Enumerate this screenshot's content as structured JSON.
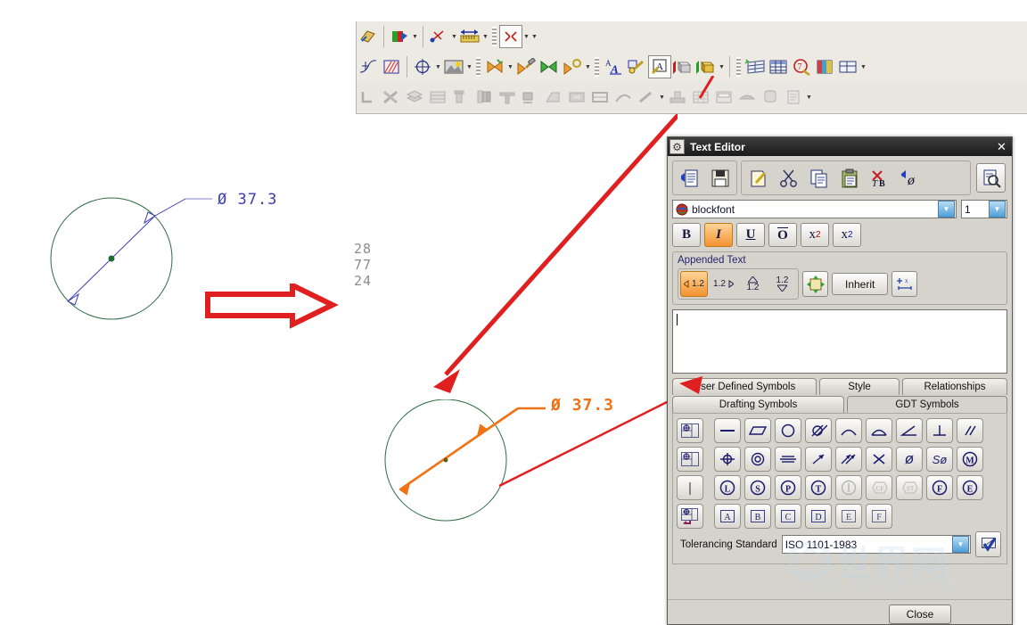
{
  "app": {
    "canvas_bg": "#ffffff",
    "accent_orange": "#ef7215",
    "accent_blue": "#3b3bb5",
    "arrow_red": "#e02020"
  },
  "cad_canvas": {
    "drawing_before": {
      "dimension_label": "Ø  37.3",
      "circle_color": "#2e6b45",
      "dimension_color": "#3b3bb5",
      "center_dot_color": "#1d6b33"
    },
    "drawing_after": {
      "dimension_label": "Ø  37.3",
      "circle_color": "#2e6b45",
      "dimension_color": "#ef7215"
    },
    "gray_numbers": [
      "28",
      "77",
      "24"
    ],
    "transition_arrow": "red-outline-right-arrow"
  },
  "cad_toolbars": {
    "row1": [
      {
        "name": "datum-plane-icon",
        "glyph": "◩",
        "disabled": false
      },
      {
        "name": "section-view-icon",
        "glyph": "◢",
        "disabled": false
      },
      {
        "name": "measure-distance-icon",
        "glyph": "↔",
        "disabled": false
      },
      {
        "name": "ruler-icon",
        "glyph": "▬",
        "disabled": false
      },
      {
        "name": "fit-view-icon",
        "glyph": "⤢",
        "disabled": false
      }
    ],
    "row2": [
      {
        "name": "spline-icon",
        "glyph": "∿",
        "disabled": false
      },
      {
        "name": "crosshatch-icon",
        "glyph": "▦",
        "disabled": false
      },
      {
        "name": "center-mark-icon",
        "glyph": "⊕",
        "disabled": false
      },
      {
        "name": "shading-icon",
        "glyph": "▣",
        "disabled": false
      },
      {
        "name": "assembly-constraint-icon",
        "glyph": "⋈",
        "disabled": false
      },
      {
        "name": "hammer-tool-icon",
        "glyph": "⚒",
        "disabled": false
      },
      {
        "name": "wrench-icon",
        "glyph": "⚙",
        "disabled": false
      },
      {
        "name": "mate-icon",
        "glyph": "⋈",
        "disabled": false
      },
      {
        "name": "annotation-font-icon",
        "glyph": "A",
        "disabled": false
      },
      {
        "name": "note-edit-icon",
        "glyph": "✎",
        "disabled": false
      },
      {
        "name": "text-tool-icon",
        "glyph": "A",
        "disabled": false,
        "active": true
      },
      {
        "name": "solid-body-gray-icon",
        "glyph": "⬛",
        "disabled": false
      },
      {
        "name": "solid-body-yellow-icon",
        "glyph": "⬛",
        "disabled": false
      },
      {
        "name": "table-new-icon",
        "glyph": "⌸",
        "disabled": false
      },
      {
        "name": "spreadsheet-icon",
        "glyph": "⌸",
        "disabled": false
      },
      {
        "name": "question-pen-icon",
        "glyph": "⍰",
        "disabled": false
      },
      {
        "name": "color-table-icon",
        "glyph": "▥",
        "disabled": false
      },
      {
        "name": "table-props-icon",
        "glyph": "▤",
        "disabled": false
      }
    ],
    "row3": [
      {
        "name": "weld-symbol-icon",
        "glyph": "⌐",
        "disabled": true
      },
      {
        "name": "tools-icon",
        "glyph": "⚒",
        "disabled": true
      },
      {
        "name": "layers-icon",
        "glyph": "☰",
        "disabled": true
      },
      {
        "name": "stack-icon",
        "glyph": "≡",
        "disabled": true
      },
      {
        "name": "bolt-icon",
        "glyph": "↓",
        "disabled": true
      },
      {
        "name": "screw-icon",
        "glyph": "↓",
        "disabled": true
      },
      {
        "name": "weldment-icon",
        "glyph": "⊥",
        "disabled": true
      },
      {
        "name": "fixture-icon",
        "glyph": "↕",
        "disabled": true
      },
      {
        "name": "block-icon",
        "glyph": "◫",
        "disabled": true
      },
      {
        "name": "plate-icon",
        "glyph": "▨",
        "disabled": true
      },
      {
        "name": "frame-icon",
        "glyph": "⊞",
        "disabled": true
      },
      {
        "name": "routing-icon",
        "glyph": "⇝",
        "disabled": true
      },
      {
        "name": "machining-icon",
        "glyph": "⚒",
        "disabled": true
      },
      {
        "name": "fixture2-icon",
        "glyph": "┴",
        "disabled": true
      },
      {
        "name": "grid-table-icon",
        "glyph": "⌸",
        "disabled": true
      },
      {
        "name": "window-icon",
        "glyph": "▣",
        "disabled": true
      },
      {
        "name": "eye-icon",
        "glyph": "◑",
        "disabled": true
      },
      {
        "name": "refresh-db-icon",
        "glyph": "⟳",
        "disabled": true
      },
      {
        "name": "report-icon",
        "glyph": "☰",
        "disabled": true
      }
    ]
  },
  "dialog": {
    "title": "Text Editor",
    "close_label": "✕",
    "gear_icon": "⚙",
    "toolbar": {
      "group1": [
        {
          "name": "import-text-button",
          "glyph": "▤",
          "label": "Import Text"
        },
        {
          "name": "save-text-button",
          "glyph": "Ὃe",
          "label": "Save Text"
        }
      ],
      "group2": [
        {
          "name": "edit-text-button",
          "glyph": "✎",
          "label": "Edit Text"
        },
        {
          "name": "cut-button",
          "glyph": "✂",
          "label": "Cut"
        },
        {
          "name": "copy-button",
          "glyph": "⧉",
          "label": "Copy"
        },
        {
          "name": "paste-button",
          "glyph": "Ὄb",
          "label": "Paste"
        },
        {
          "name": "clear-formatting-button",
          "glyph": "✗",
          "label": "Clear Formatting"
        },
        {
          "name": "insert-symbol-button",
          "glyph": "ø",
          "label": "Insert Symbol"
        }
      ],
      "group3": [
        {
          "name": "preview-button",
          "glyph": "ὐd",
          "label": "Preview"
        }
      ]
    },
    "font": {
      "name": "blockfont",
      "icon": "font-globe-icon",
      "size": "1"
    },
    "style_buttons": [
      {
        "name": "bold-button",
        "label": "B",
        "active": false
      },
      {
        "name": "italic-button",
        "label": "I",
        "active": true
      },
      {
        "name": "underline-button",
        "label": "U",
        "active": false
      },
      {
        "name": "overline-button",
        "label": "O",
        "active": false
      },
      {
        "name": "superscript-button",
        "label": "x",
        "sup": "2",
        "active": false
      },
      {
        "name": "subscript-button",
        "label": "x",
        "sub": "2",
        "active": false
      }
    ],
    "appended_text": {
      "label": "Appended Text",
      "position_buttons": [
        {
          "name": "append-before-button",
          "label": "1.2",
          "active": true
        },
        {
          "name": "append-after-button",
          "label": "1.2",
          "active": false
        },
        {
          "name": "append-above-button",
          "label": "1.2",
          "active": false
        },
        {
          "name": "append-below-button",
          "label": "1.2",
          "active": false
        }
      ],
      "style_icon_button": {
        "name": "text-style-button",
        "glyph": "✥"
      },
      "inherit_button": {
        "name": "inherit-button",
        "label": "Inherit"
      },
      "spacing_button": {
        "name": "text-spacing-button",
        "glyph": "⊥"
      }
    },
    "text_area": {
      "value": "",
      "placeholder": ""
    },
    "tabs": {
      "row1": [
        {
          "name": "tab-user-defined-symbols",
          "label": "User Defined Symbols",
          "active": false
        },
        {
          "name": "tab-style",
          "label": "Style",
          "active": false
        },
        {
          "name": "tab-relationships",
          "label": "Relationships",
          "active": false
        }
      ],
      "row2": [
        {
          "name": "tab-drafting-symbols",
          "label": "Drafting Symbols",
          "active": false
        },
        {
          "name": "tab-gdt-symbols",
          "label": "GDT Symbols",
          "active": true
        }
      ]
    },
    "gdt_symbols": {
      "row1": [
        {
          "name": "feature-control-frame-icon",
          "glyph": "fcf",
          "disabled": false,
          "gap": true
        },
        {
          "name": "straightness-icon",
          "glyph": "—",
          "disabled": false
        },
        {
          "name": "flatness-icon",
          "glyph": "▱",
          "disabled": false
        },
        {
          "name": "circularity-icon",
          "glyph": "○",
          "disabled": false
        },
        {
          "name": "cylindricity-icon",
          "glyph": "cyl",
          "disabled": false
        },
        {
          "name": "profile-line-icon",
          "glyph": "⌒",
          "disabled": false
        },
        {
          "name": "profile-surface-icon",
          "glyph": "prof",
          "disabled": false
        },
        {
          "name": "angularity-icon",
          "glyph": "∠",
          "disabled": false
        },
        {
          "name": "perpendicularity-icon",
          "glyph": "⊥",
          "disabled": false
        },
        {
          "name": "parallelism-icon",
          "glyph": "∥",
          "disabled": false
        }
      ],
      "row2": [
        {
          "name": "feature-control-frame-2-icon",
          "glyph": "fcf",
          "disabled": false,
          "gap": true
        },
        {
          "name": "position-icon",
          "glyph": "⊕",
          "disabled": false
        },
        {
          "name": "concentricity-icon",
          "glyph": "◎",
          "disabled": false
        },
        {
          "name": "symmetry-icon",
          "glyph": "≡",
          "disabled": false
        },
        {
          "name": "circular-runout-icon",
          "glyph": "↗",
          "disabled": false
        },
        {
          "name": "total-runout-icon",
          "glyph": "⇈",
          "disabled": false
        },
        {
          "name": "counterbore-x-icon",
          "glyph": "✕",
          "disabled": false
        },
        {
          "name": "diameter-icon",
          "glyph": "ø",
          "disabled": false
        },
        {
          "name": "spherical-diameter-icon",
          "glyph": "Sø",
          "disabled": false
        },
        {
          "name": "mmc-icon",
          "glyph": "M",
          "disabled": false
        }
      ],
      "row3": [
        {
          "name": "separator-bar-icon",
          "glyph": "|",
          "disabled": false,
          "gap": true
        },
        {
          "name": "lmc-icon",
          "glyph": "L",
          "disabled": false
        },
        {
          "name": "rfs-icon",
          "glyph": "S",
          "disabled": false
        },
        {
          "name": "projected-tolerance-icon",
          "glyph": "P",
          "disabled": false
        },
        {
          "name": "tangent-plane-icon",
          "glyph": "T",
          "disabled": false
        },
        {
          "name": "independency-icon",
          "glyph": "I",
          "disabled": true
        },
        {
          "name": "continuous-feature-icon",
          "glyph": "CF",
          "disabled": true
        },
        {
          "name": "statistical-tolerance-icon",
          "glyph": "ST",
          "disabled": true
        },
        {
          "name": "free-state-icon",
          "glyph": "F",
          "disabled": false
        },
        {
          "name": "envelope-icon",
          "glyph": "E",
          "disabled": false
        }
      ],
      "row4": [
        {
          "name": "datum-feature-symbol-icon",
          "glyph": "dfs",
          "disabled": false,
          "gap": true
        },
        {
          "name": "datum-a-icon",
          "glyph": "A",
          "disabled": false
        },
        {
          "name": "datum-b-icon",
          "glyph": "B",
          "disabled": false
        },
        {
          "name": "datum-c-icon",
          "glyph": "C",
          "disabled": false
        },
        {
          "name": "datum-d-icon",
          "glyph": "D",
          "disabled": false
        },
        {
          "name": "datum-e-icon",
          "glyph": "E",
          "disabled": false
        },
        {
          "name": "datum-f-icon",
          "glyph": "F",
          "disabled": false
        }
      ]
    },
    "tolerancing": {
      "label": "Tolerancing Standard",
      "value": "ISO 1101-1983",
      "apply_button": {
        "name": "apply-tolerance-button",
        "glyph": "✔"
      }
    },
    "footer": {
      "close_label": "Close"
    }
  },
  "watermark": {
    "cn_text": "世界网",
    "url_text": "WWW.3DSJW.COM"
  }
}
